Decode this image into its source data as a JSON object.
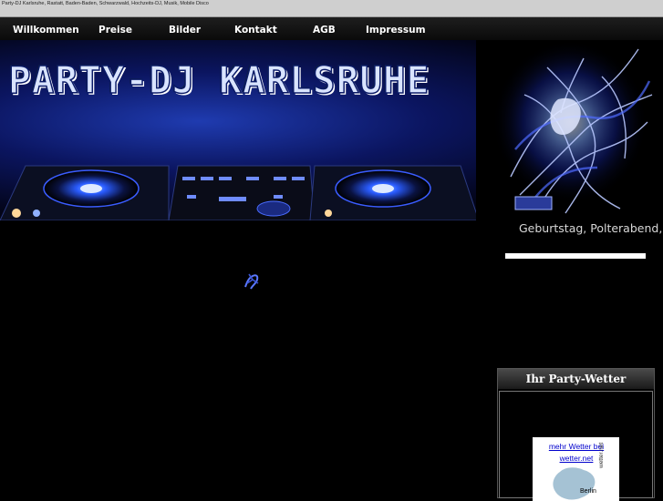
{
  "top_bar": {
    "text": "Party-DJ Karlsruhe, Rastatt, Baden-Baden, Schwarzwald, Hochzeits-DJ, Musik, Mobile Disco"
  },
  "nav": {
    "items": [
      {
        "label": "Willkommen"
      },
      {
        "label": "Preise"
      },
      {
        "label": "Bilder"
      },
      {
        "label": "Kontakt"
      },
      {
        "label": "AGB"
      },
      {
        "label": "Impressum"
      }
    ]
  },
  "banner": {
    "title": "PARTY-DJ KARLSRUHE"
  },
  "slogan": "Geburtstag, Polterabend,",
  "weather_widget": {
    "title": "Ihr Party-Wetter",
    "link_text": "mehr Wetter bei wetter.net",
    "city": "Berlin",
    "brand": "wetter.net"
  },
  "colors": {
    "background": "#000000",
    "nav_text": "#ffffff",
    "link": "#0000cc",
    "banner_blue": "#1f3bb0"
  }
}
